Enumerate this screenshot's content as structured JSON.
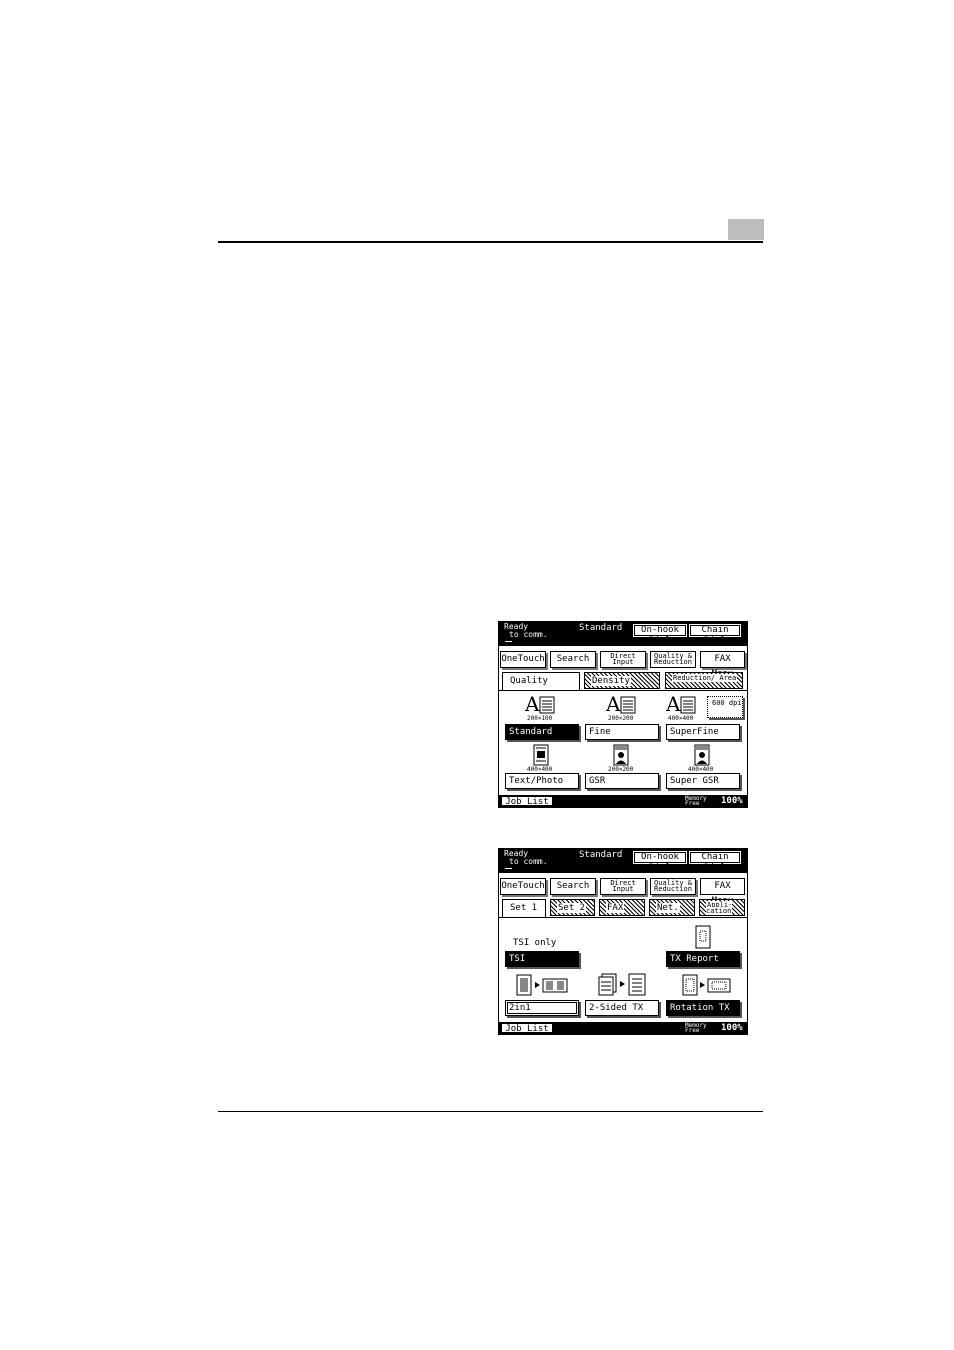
{
  "screen1": {
    "status": {
      "ready_line1": "Ready",
      "ready_line2": "to comm.",
      "mode": "Standard",
      "onhook": "On-hook Dial",
      "chain": "Chain Dial"
    },
    "menu": [
      "OneTouch",
      "Search",
      "Direct Input",
      "Quality & Reduction",
      "FAX Menu"
    ],
    "tabs": [
      "Quality",
      "Density",
      "Reduction/ Area"
    ],
    "resolutions": [
      "200×100",
      "200×200",
      "400×400"
    ],
    "dpi": "600 dpi",
    "row1_buttons": [
      "Standard",
      "Fine",
      "SuperFine"
    ],
    "row2_resolutions": [
      "400×400",
      "200×200",
      "400×400"
    ],
    "row2_buttons": [
      "Text/Photo",
      "GSR",
      "Super GSR"
    ],
    "bottom": {
      "job_list": "Job List",
      "memory_line1": "Memory",
      "memory_line2": "Free",
      "percent": "100%"
    }
  },
  "screen2": {
    "status": {
      "ready_line1": "Ready",
      "ready_line2": "to comm.",
      "mode": "Standard",
      "onhook": "On-hook Dial",
      "chain": "Chain Dial"
    },
    "menu": [
      "OneTouch",
      "Search",
      "Direct Input",
      "Quality & Reduction",
      "FAX Menu"
    ],
    "tabs": [
      "Set 1",
      "Set 2",
      "FAX",
      "Net.",
      "Appli- cation"
    ],
    "tsi_only": "TSI only",
    "buttons": {
      "tsi": "TSI",
      "tx_report": "TX Report",
      "two_in_one": "2in1",
      "two_sided": "2-Sided TX",
      "rotation": "Rotation TX"
    },
    "bottom": {
      "job_list": "Job List",
      "memory_line1": "Memory",
      "memory_line2": "Free",
      "percent": "100%"
    }
  }
}
